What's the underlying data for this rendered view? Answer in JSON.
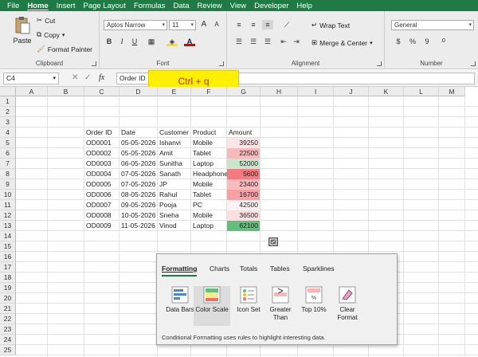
{
  "menu": [
    "File",
    "Home",
    "Insert",
    "Page Layout",
    "Formulas",
    "Data",
    "Review",
    "View",
    "Developer",
    "Help"
  ],
  "ribbon": {
    "clipboard": {
      "paste": "Paste",
      "cut": "Cut",
      "copy": "Copy",
      "format_painter": "Format Painter",
      "label": "Clipboard"
    },
    "font": {
      "name": "Aptos Narrow",
      "size": "11",
      "label": "Font",
      "bold": "B",
      "italic": "I",
      "underline": "U",
      "fontsize_up": "A",
      "fontsize_down": "A"
    },
    "alignment": {
      "wrap": "Wrap Text",
      "merge": "Merge & Center",
      "label": "Alignment"
    },
    "number": {
      "format": "General",
      "currency": "$",
      "percent": "%",
      "comma": "9",
      "inc": ".0",
      "label": "Number"
    }
  },
  "formula_bar": {
    "name_box": "C4",
    "fx": "fx",
    "content": "Order ID"
  },
  "keyboard_overlay": "Ctrl + q",
  "columns": [
    "A",
    "B",
    "C",
    "D",
    "E",
    "F",
    "G",
    "H",
    "I",
    "J",
    "K",
    "L",
    "M"
  ],
  "rows": [
    "1",
    "2",
    "3",
    "4",
    "5",
    "6",
    "7",
    "8",
    "9",
    "10",
    "11",
    "12",
    "13",
    "14",
    "15",
    "16",
    "17",
    "18",
    "19",
    "20",
    "21",
    "22",
    "23",
    "24",
    "25"
  ],
  "table": {
    "headers": [
      "Order ID",
      "Date",
      "Customer",
      "Product",
      "Amount"
    ],
    "rows": [
      {
        "id": "OD0001",
        "date": "05-05-2026",
        "customer": "Ishanvi",
        "product": "Mobile",
        "amount": "39250",
        "color": "#fde5e7"
      },
      {
        "id": "OD0002",
        "date": "05-05-2026",
        "customer": "Amit",
        "product": "Tablet",
        "amount": "22500",
        "color": "#f7b9bc"
      },
      {
        "id": "OD0003",
        "date": "06-05-2026",
        "customer": "Sunitha",
        "product": "Laptop",
        "amount": "52000",
        "color": "#c9e5cc"
      },
      {
        "id": "OD0004",
        "date": "07-05-2026",
        "customer": "Sanath",
        "product": "Headphones",
        "amount": "5600",
        "color": "#f47a7f"
      },
      {
        "id": "OD0005",
        "date": "07-05-2026",
        "customer": "JP",
        "product": "Mobile",
        "amount": "23400",
        "color": "#f8bcbf"
      },
      {
        "id": "OD0006",
        "date": "08-05-2026",
        "customer": "Rahul",
        "product": "Tablet",
        "amount": "16700",
        "color": "#f4a0a4"
      },
      {
        "id": "OD0007",
        "date": "09-05-2026",
        "customer": "Pooja",
        "product": "PC",
        "amount": "42500",
        "color": "#fbf3f3"
      },
      {
        "id": "OD0008",
        "date": "10-05-2026",
        "customer": "Sneha",
        "product": "Mobile",
        "amount": "36500",
        "color": "#fcdfe1"
      },
      {
        "id": "OD0009",
        "date": "11-05-2026",
        "customer": "Vinod",
        "product": "Laptop",
        "amount": "62100",
        "color": "#63be7b"
      }
    ]
  },
  "quick_analysis": {
    "tabs": [
      "Formatting",
      "Charts",
      "Totals",
      "Tables",
      "Sparklines"
    ],
    "items": [
      "Data Bars",
      "Color Scale",
      "Icon Set",
      "Greater Than",
      "Top 10%",
      "Clear Format"
    ],
    "footer": "Conditional Formatting uses rules to highlight interesting data."
  }
}
